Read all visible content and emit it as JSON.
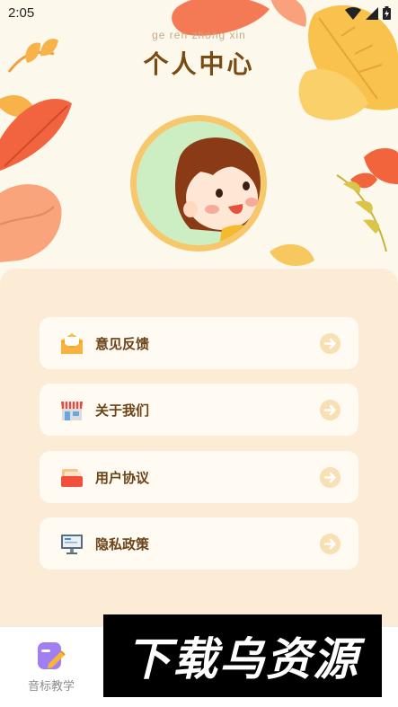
{
  "status_bar": {
    "time": "2:05"
  },
  "header": {
    "subtitle": "ge ren zhong xin",
    "title": "个人中心"
  },
  "menu": [
    {
      "label": "意见反馈",
      "icon": "mail-icon"
    },
    {
      "label": "关于我们",
      "icon": "shop-icon"
    },
    {
      "label": "用户协议",
      "icon": "document-icon"
    },
    {
      "label": "隐私政策",
      "icon": "computer-icon"
    }
  ],
  "bottom_nav": {
    "items": [
      {
        "label": "音标教学",
        "icon": "notebook-pen-icon"
      }
    ]
  },
  "watermark": {
    "text": "下载乌资源"
  },
  "colors": {
    "accent": "#f6c76b",
    "title": "#7a4a12",
    "panel": "#fcecd5"
  }
}
